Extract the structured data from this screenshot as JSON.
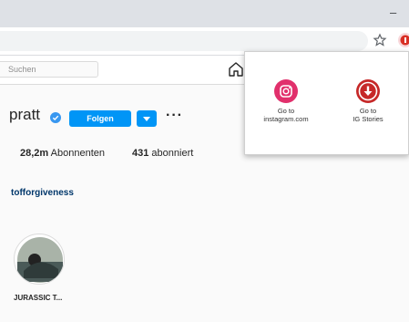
{
  "search": {
    "placeholder": "Suchen"
  },
  "profile": {
    "username": "pratt",
    "follow_label": "Folgen",
    "more_label": "···",
    "followers_count": "28,2m",
    "followers_label": "Abonnenten",
    "following_count": "431",
    "following_label": "abonniert",
    "bio_link": "tofforgiveness"
  },
  "highlights": [
    {
      "label": "JURASSIC T..."
    }
  ],
  "popup": {
    "items": [
      {
        "line1": "Go to",
        "line2": "instagram.com",
        "icon": "instagram-icon"
      },
      {
        "line1": "Go to",
        "line2": "IG Stories",
        "icon": "download-arrow-icon"
      }
    ]
  },
  "colors": {
    "accent": "#0095f6",
    "instagram_grad": "#e1306c",
    "stories_red": "#c62828"
  }
}
